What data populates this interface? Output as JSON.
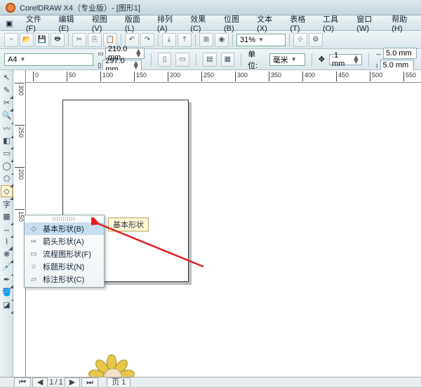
{
  "title": "CorelDRAW X4（专业版）- [图形1]",
  "menu": [
    "文件(F)",
    "编辑(E)",
    "视图(V)",
    "版面(L)",
    "排列(A)",
    "效果(C)",
    "位图(B)",
    "文本(X)",
    "表格(T)",
    "工具(O)",
    "窗口(W)",
    "帮助(H)"
  ],
  "zoom": "31%",
  "paper_name": "A4",
  "paper_w": "210.0 mm",
  "paper_h": "297.0 mm",
  "unit_label": "单位:",
  "unit_value": "毫米",
  "nudge": ".1 mm",
  "dup_x": "5.0 mm",
  "dup_y": "5.0 mm",
  "ruler_h": [
    "0",
    "50",
    "100",
    "150",
    "200",
    "250",
    "300",
    "350",
    "400",
    "450",
    "500",
    "550"
  ],
  "ruler_v": [
    "300",
    "250",
    "200",
    "150"
  ],
  "flyout": {
    "items": [
      {
        "icon": "◇",
        "label": "基本形状(B)"
      },
      {
        "icon": "⇨",
        "label": "箭头形状(A)"
      },
      {
        "icon": "▭",
        "label": "流程图形状(F)"
      },
      {
        "icon": "☆",
        "label": "标题形状(N)"
      },
      {
        "icon": "▱",
        "label": "标注形状(C)"
      }
    ]
  },
  "tooltip": "基本形状",
  "bottom": {
    "nav": [
      "⏮",
      "◀",
      "1",
      "/",
      "1",
      "▶",
      "⏭"
    ],
    "page": "页 1"
  }
}
